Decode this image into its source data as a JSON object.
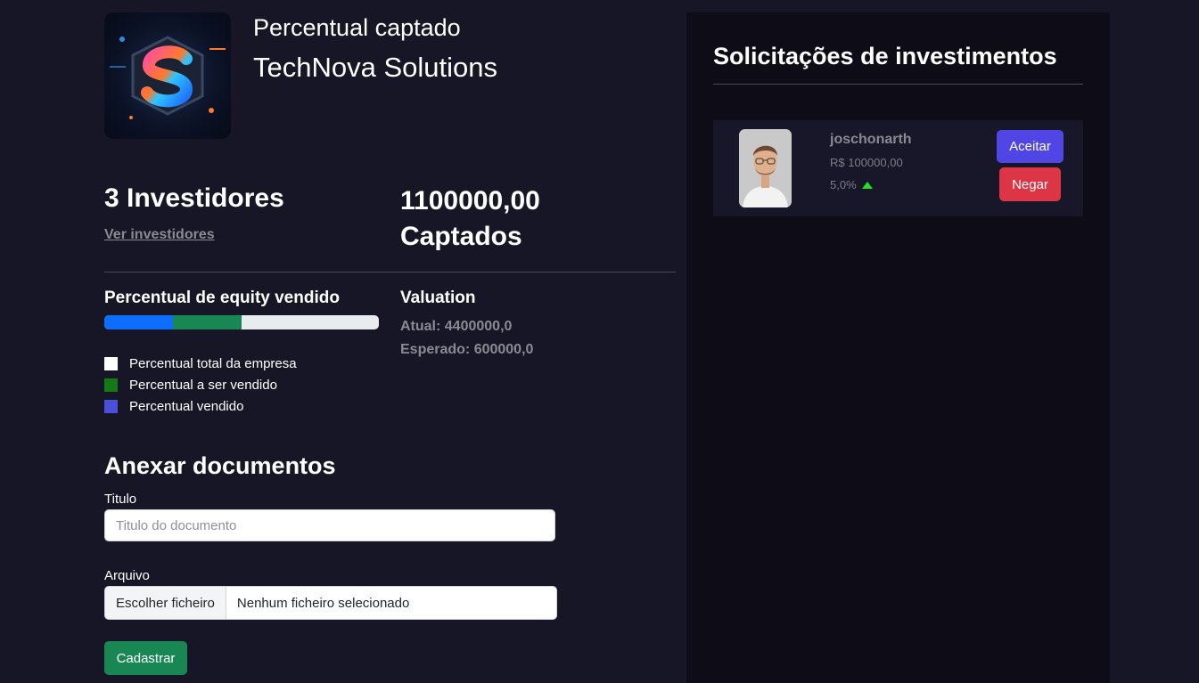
{
  "header": {
    "logo_icon": "technova-logo-icon",
    "subtitle": "Percentual captado",
    "company_name": "TechNova Solutions"
  },
  "stats": {
    "investors": "3 Investidores",
    "view_investors_link": "Ver investidores",
    "raised_amount": "1100000,00",
    "raised_label": "Captados"
  },
  "equity": {
    "title": "Percentual de equity vendido",
    "progress": {
      "sold_fraction": 0.25,
      "to_be_sold_fraction": 0.25
    },
    "legend": [
      {
        "label": "Percentual total da empresa",
        "color": "#ffffff"
      },
      {
        "label": "Percentual a ser vendido",
        "color": "#157a15"
      },
      {
        "label": "Percentual vendido",
        "color": "#4b4fd9"
      }
    ],
    "bar_colors": {
      "sold": "#0d6efd",
      "to_be_sold": "#198754",
      "total": "#e9ecef"
    }
  },
  "valuation": {
    "title": "Valuation",
    "current": "Atual: 4400000,0",
    "expected": "Esperado: 600000,0"
  },
  "documents": {
    "title": "Anexar documentos",
    "title_label": "Titulo",
    "title_placeholder": "Titulo do documento",
    "file_label": "Arquivo",
    "file_button": "Escolher ficheiro",
    "file_status": "Nenhum ficheiro selecionado",
    "submit": "Cadastrar"
  },
  "requests": {
    "title": "Solicitações de investimentos",
    "items": [
      {
        "avatar_icon": "user-avatar-icon",
        "username": "joschonarth",
        "amount": "R$ 100000,00",
        "percent": "5,0%",
        "trend_icon": "arrow-up-icon",
        "accept": "Aceitar",
        "deny": "Negar"
      }
    ]
  },
  "colors": {
    "background": "#171627",
    "panel": "#0e0d17",
    "card": "#18172a",
    "accept": "#4f46e5",
    "deny": "#dc3545",
    "submit": "#198754"
  }
}
